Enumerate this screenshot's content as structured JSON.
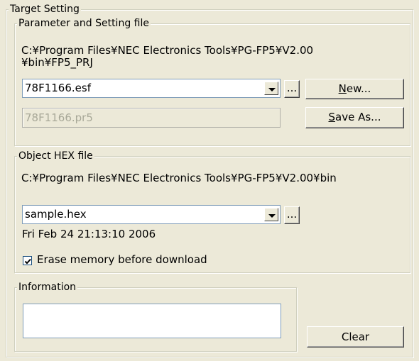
{
  "target_setting": {
    "legend": "Target Setting",
    "param_group": {
      "legend": "Parameter and Setting file",
      "path_line1": "C:¥Program Files¥NEC Electronics Tools¥PG-FP5¥V2.00",
      "path_line2": "¥bin¥FP5_PRJ",
      "esf_combo_value": "78F1166.esf",
      "browse_label": "...",
      "new_label_u": "N",
      "new_label_rest": "ew...",
      "pr5_value": "78F1166.pr5",
      "save_as_label_u": "S",
      "save_as_label_rest": "ave As..."
    },
    "hex_group": {
      "legend": "Object HEX file",
      "path": "C:¥Program Files¥NEC Electronics Tools¥PG-FP5¥V2.00¥bin",
      "hex_combo_value": "sample.hex",
      "browse_label": "...",
      "timestamp": "Fri Feb 24 21:13:10 2006",
      "erase_checkbox_label": "Erase memory before download",
      "erase_checked": true
    },
    "info_group": {
      "legend": "Information",
      "content": ""
    },
    "clear_label": "Clear"
  }
}
